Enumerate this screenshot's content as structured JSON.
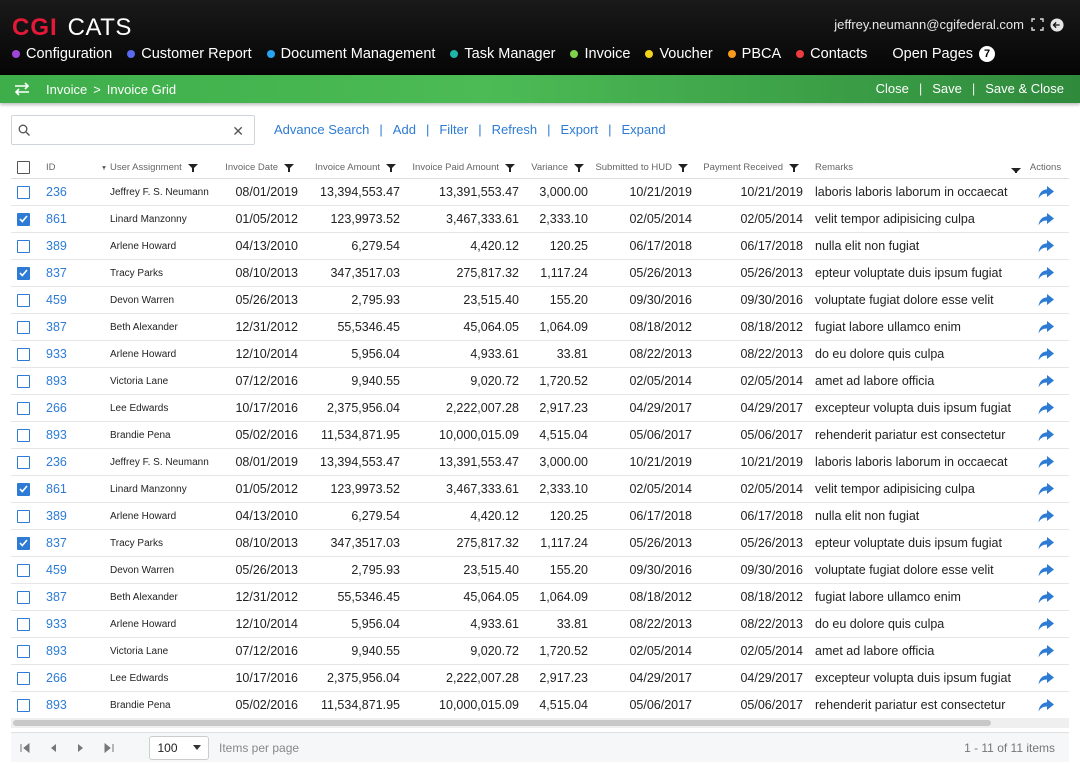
{
  "header": {
    "brand_mark": "CGI",
    "app_name": "CATS",
    "user_email": "jeffrey.neumann@cgifederal.com",
    "nav": [
      {
        "label": "Configuration",
        "color": "#a044d8"
      },
      {
        "label": "Customer Report",
        "color": "#5a6af0"
      },
      {
        "label": "Document Management",
        "color": "#26a5f0"
      },
      {
        "label": "Task Manager",
        "color": "#1fb5a8"
      },
      {
        "label": "Invoice",
        "color": "#7ed24c"
      },
      {
        "label": "Voucher",
        "color": "#f2d41c"
      },
      {
        "label": "PBCA",
        "color": "#f59a1c"
      },
      {
        "label": "Contacts",
        "color": "#ee3b3b"
      }
    ],
    "open_pages_label": "Open Pages",
    "open_pages_count": "7"
  },
  "breadcrumb": {
    "items": [
      "Invoice",
      ">",
      "Invoice Grid"
    ],
    "actions": {
      "close": "Close",
      "save": "Save",
      "save_close": "Save & Close",
      "sep": "|"
    }
  },
  "toolbar": {
    "search_placeholder": "",
    "clear_symbol": "✕",
    "links": [
      "Advance Search",
      "Add",
      "Filter",
      "Refresh",
      "Export",
      "Expand"
    ],
    "sep": "|"
  },
  "table": {
    "columns": {
      "id": "ID",
      "user": "User Assignment",
      "invoice_date": "Invoice Date",
      "invoice_amount": "Invoice Amount",
      "paid_amount": "Invoice Paid Amount",
      "variance": "Variance",
      "submitted": "Submitted to HUD",
      "payment": "Payment Received",
      "remarks": "Remarks",
      "actions": "Actions"
    },
    "rows": [
      {
        "checked": false,
        "id": "236",
        "user": "Jeffrey F. S. Neumann",
        "invoice_date": "08/01/2019",
        "invoice_amount": "13,394,553.47",
        "paid_amount": "13,391,553.47",
        "variance": "3,000.00",
        "submitted": "10/21/2019",
        "payment": "10/21/2019",
        "remarks": "laboris laboris laborum in occaecat"
      },
      {
        "checked": true,
        "id": "861",
        "user": "Linard Manzonny",
        "invoice_date": "01/05/2012",
        "invoice_amount": "123,9973.52",
        "paid_amount": "3,467,333.61",
        "variance": "2,333.10",
        "submitted": "02/05/2014",
        "payment": "02/05/2014",
        "remarks": "velit tempor adipisicing culpa"
      },
      {
        "checked": false,
        "id": "389",
        "user": "Arlene Howard",
        "invoice_date": "04/13/2010",
        "invoice_amount": "6,279.54",
        "paid_amount": "4,420.12",
        "variance": "120.25",
        "submitted": "06/17/2018",
        "payment": "06/17/2018",
        "remarks": "nulla elit non fugiat"
      },
      {
        "checked": true,
        "id": "837",
        "user": "Tracy Parks",
        "invoice_date": "08/10/2013",
        "invoice_amount": "347,3517.03",
        "paid_amount": "275,817.32",
        "variance": "1,117.24",
        "submitted": "05/26/2013",
        "payment": "05/26/2013",
        "remarks": "epteur voluptate duis ipsum fugiat"
      },
      {
        "checked": false,
        "id": "459",
        "user": "Devon Warren",
        "invoice_date": "05/26/2013",
        "invoice_amount": "2,795.93",
        "paid_amount": "23,515.40",
        "variance": "155.20",
        "submitted": "09/30/2016",
        "payment": "09/30/2016",
        "remarks": "voluptate fugiat dolore esse velit"
      },
      {
        "checked": false,
        "id": "387",
        "user": "Beth Alexander",
        "invoice_date": "12/31/2012",
        "invoice_amount": "55,5346.45",
        "paid_amount": "45,064.05",
        "variance": "1,064.09",
        "submitted": "08/18/2012",
        "payment": "08/18/2012",
        "remarks": "fugiat labore ullamco enim"
      },
      {
        "checked": false,
        "id": "933",
        "user": "Arlene Howard",
        "invoice_date": "12/10/2014",
        "invoice_amount": "5,956.04",
        "paid_amount": "4,933.61",
        "variance": "33.81",
        "submitted": "08/22/2013",
        "payment": "08/22/2013",
        "remarks": "do eu dolore quis culpa"
      },
      {
        "checked": false,
        "id": "893",
        "user": "Victoria Lane",
        "invoice_date": "07/12/2016",
        "invoice_amount": "9,940.55",
        "paid_amount": "9,020.72",
        "variance": "1,720.52",
        "submitted": "02/05/2014",
        "payment": "02/05/2014",
        "remarks": "amet ad labore officia"
      },
      {
        "checked": false,
        "id": "266",
        "user": "Lee Edwards",
        "invoice_date": "10/17/2016",
        "invoice_amount": "2,375,956.04",
        "paid_amount": "2,222,007.28",
        "variance": "2,917.23",
        "submitted": "04/29/2017",
        "payment": "04/29/2017",
        "remarks": "excepteur volupta duis ipsum fugiat"
      },
      {
        "checked": false,
        "id": "893",
        "user": "Brandie Pena",
        "invoice_date": "05/02/2016",
        "invoice_amount": "11,534,871.95",
        "paid_amount": "10,000,015.09",
        "variance": "4,515.04",
        "submitted": "05/06/2017",
        "payment": "05/06/2017",
        "remarks": "rehenderit pariatur est consectetur"
      },
      {
        "checked": false,
        "id": "236",
        "user": "Jeffrey F. S. Neumann",
        "invoice_date": "08/01/2019",
        "invoice_amount": "13,394,553.47",
        "paid_amount": "13,391,553.47",
        "variance": "3,000.00",
        "submitted": "10/21/2019",
        "payment": "10/21/2019",
        "remarks": "laboris laboris laborum in occaecat"
      },
      {
        "checked": true,
        "id": "861",
        "user": "Linard Manzonny",
        "invoice_date": "01/05/2012",
        "invoice_amount": "123,9973.52",
        "paid_amount": "3,467,333.61",
        "variance": "2,333.10",
        "submitted": "02/05/2014",
        "payment": "02/05/2014",
        "remarks": "velit tempor adipisicing culpa"
      },
      {
        "checked": false,
        "id": "389",
        "user": "Arlene Howard",
        "invoice_date": "04/13/2010",
        "invoice_amount": "6,279.54",
        "paid_amount": "4,420.12",
        "variance": "120.25",
        "submitted": "06/17/2018",
        "payment": "06/17/2018",
        "remarks": "nulla elit non fugiat"
      },
      {
        "checked": true,
        "id": "837",
        "user": "Tracy Parks",
        "invoice_date": "08/10/2013",
        "invoice_amount": "347,3517.03",
        "paid_amount": "275,817.32",
        "variance": "1,117.24",
        "submitted": "05/26/2013",
        "payment": "05/26/2013",
        "remarks": "epteur voluptate duis ipsum fugiat"
      },
      {
        "checked": false,
        "id": "459",
        "user": "Devon Warren",
        "invoice_date": "05/26/2013",
        "invoice_amount": "2,795.93",
        "paid_amount": "23,515.40",
        "variance": "155.20",
        "submitted": "09/30/2016",
        "payment": "09/30/2016",
        "remarks": "voluptate fugiat dolore esse velit"
      },
      {
        "checked": false,
        "id": "387",
        "user": "Beth Alexander",
        "invoice_date": "12/31/2012",
        "invoice_amount": "55,5346.45",
        "paid_amount": "45,064.05",
        "variance": "1,064.09",
        "submitted": "08/18/2012",
        "payment": "08/18/2012",
        "remarks": "fugiat labore ullamco enim"
      },
      {
        "checked": false,
        "id": "933",
        "user": "Arlene Howard",
        "invoice_date": "12/10/2014",
        "invoice_amount": "5,956.04",
        "paid_amount": "4,933.61",
        "variance": "33.81",
        "submitted": "08/22/2013",
        "payment": "08/22/2013",
        "remarks": "do eu dolore quis culpa"
      },
      {
        "checked": false,
        "id": "893",
        "user": "Victoria Lane",
        "invoice_date": "07/12/2016",
        "invoice_amount": "9,940.55",
        "paid_amount": "9,020.72",
        "variance": "1,720.52",
        "submitted": "02/05/2014",
        "payment": "02/05/2014",
        "remarks": "amet ad labore officia"
      },
      {
        "checked": false,
        "id": "266",
        "user": "Lee Edwards",
        "invoice_date": "10/17/2016",
        "invoice_amount": "2,375,956.04",
        "paid_amount": "2,222,007.28",
        "variance": "2,917.23",
        "submitted": "04/29/2017",
        "payment": "04/29/2017",
        "remarks": "excepteur volupta duis ipsum fugiat"
      },
      {
        "checked": false,
        "id": "893",
        "user": "Brandie Pena",
        "invoice_date": "05/02/2016",
        "invoice_amount": "11,534,871.95",
        "paid_amount": "10,000,015.09",
        "variance": "4,515.04",
        "submitted": "05/06/2017",
        "payment": "05/06/2017",
        "remarks": "rehenderit pariatur est consectetur"
      }
    ]
  },
  "pager": {
    "page_size": "100",
    "items_per_page_label": "Items per page",
    "count_label": "1 - 11 of 11 items"
  },
  "icons": {
    "expand": "expand-arrows-icon",
    "logout": "logout-icon",
    "swap": "swap-arrows-icon",
    "search": "search-icon",
    "filter": "filter-icon",
    "row_action": "share-arrow-icon"
  }
}
